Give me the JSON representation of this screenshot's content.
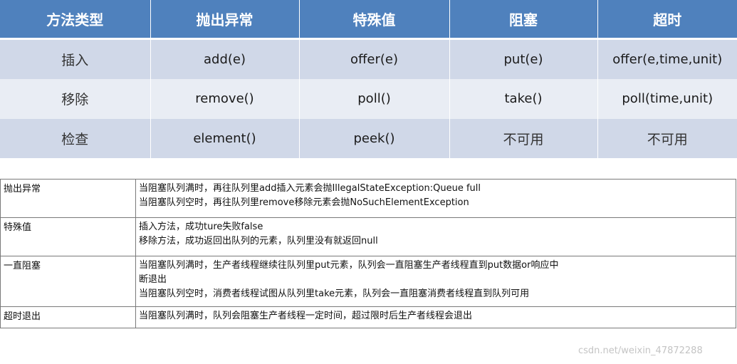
{
  "methods_table": {
    "headers": [
      "方法类型",
      "抛出异常",
      "特殊值",
      "阻塞",
      "超时"
    ],
    "rows": [
      {
        "label": "插入",
        "cells": [
          "add(e)",
          "offer(e)",
          "put(e)",
          "offer(e,time,unit)"
        ]
      },
      {
        "label": "移除",
        "cells": [
          "remove()",
          "poll()",
          "take()",
          "poll(time,unit)"
        ]
      },
      {
        "label": "检查",
        "cells": [
          "element()",
          "peek()",
          "不可用",
          "不可用"
        ]
      }
    ],
    "colors": {
      "header_bg": "#4f81bd",
      "row_dark": "#d0d8e8",
      "row_light": "#e9edf4"
    }
  },
  "desc_table": {
    "rows": [
      {
        "key": "抛出异常",
        "lines": [
          "当阻塞队列满时，再往队列里add插入元素会抛IllegalStateException:Queue full",
          "当阻塞队列空时，再往队列里remove移除元素会抛NoSuchElementException"
        ]
      },
      {
        "key": "特殊值",
        "lines": [
          "插入方法，成功ture失败false",
          "移除方法，成功返回出队列的元素，队列里没有就返回null"
        ]
      },
      {
        "key": "一直阻塞",
        "lines": [
          "当阻塞队列满时，生产者线程继续往队列里put元素，队列会一直阻塞生产者线程直到put数据or响应中",
          "断退出",
          "当阻塞队列空时，消费者线程试图从队列里take元素，队列会一直阻塞消费者线程直到队列可用"
        ]
      },
      {
        "key": "超时退出",
        "lines": [
          "当阻塞队列满时，队列会阻塞生产者线程一定时间，超过限时后生产者线程会退出"
        ]
      }
    ]
  },
  "watermark": "csdn.net/weixin_47872288"
}
